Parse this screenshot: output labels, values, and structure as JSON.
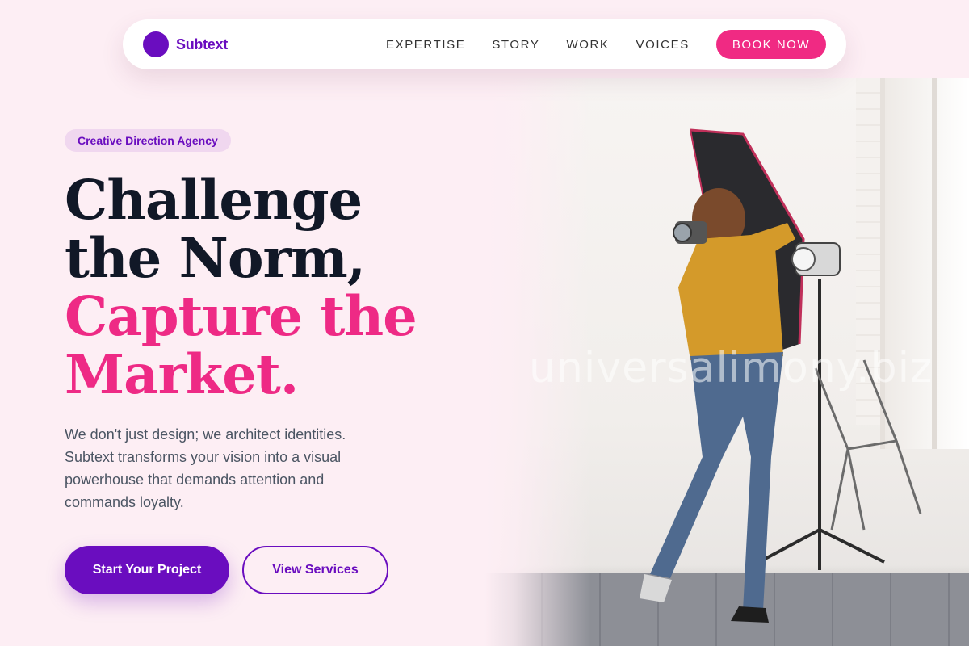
{
  "brand": {
    "name": "Subtext",
    "logo_icon": "purple-circle-logo",
    "color": "#6a0dbf"
  },
  "nav": {
    "links": [
      "EXPERTISE",
      "STORY",
      "WORK",
      "VOICES"
    ],
    "cta": "BOOK NOW",
    "cta_color": "#f02a83"
  },
  "hero": {
    "badge": "Creative Direction Agency",
    "headline_dark": [
      "Challenge",
      "the Norm,"
    ],
    "headline_accent": [
      "Capture the",
      "Market."
    ],
    "accent_color": "#ee2a85",
    "subcopy": "We don't just design; we architect identities. Subtext transforms your vision into a visual powerhouse that demands attention and commands loyalty.",
    "primary_button": "Start Your Project",
    "secondary_button": "View Services"
  },
  "photo": {
    "description_icon": "photographer-studio-photo",
    "watermark": "universalimony.biz"
  }
}
